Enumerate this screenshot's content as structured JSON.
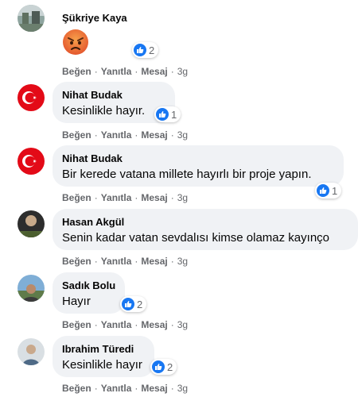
{
  "actions": {
    "like": "Beğen",
    "reply": "Yanıtla",
    "message": "Mesaj",
    "separator": "·"
  },
  "comments": [
    {
      "name": "Şükriye Kaya",
      "text": "",
      "reaction_count": "2",
      "time": "3g",
      "emoji": "angry-face-emoji"
    },
    {
      "name": "Nihat Budak",
      "text": "Kesinlikle hayır.",
      "reaction_count": "1",
      "time": "3g"
    },
    {
      "name": "Nihat Budak",
      "text": "Bir kerede vatana millete hayırlı bir proje yapın.",
      "reaction_count": "1",
      "time": "3g"
    },
    {
      "name": "Hasan Akgül",
      "text": "Senin kadar vatan sevdalısı kimse olamaz kayınço",
      "reaction_count": "",
      "time": "3g"
    },
    {
      "name": "Sadık Bolu",
      "text": "Hayır",
      "reaction_count": "2",
      "time": "3g"
    },
    {
      "name": "Ibrahim Türedi",
      "text": "Kesinlikle hayır",
      "reaction_count": "2",
      "time": "3g"
    }
  ],
  "colors": {
    "like_blue": "#1877f2",
    "bubble": "#f0f2f5",
    "muted": "#65676b",
    "flag_red": "#e30a17"
  }
}
